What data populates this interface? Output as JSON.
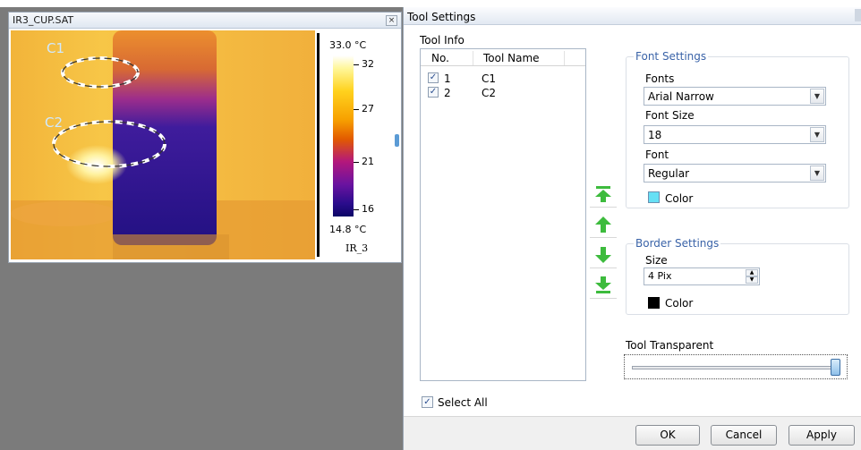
{
  "image_window": {
    "title": "IR3_CUP.SAT",
    "close_glyph": "×",
    "overlays": [
      {
        "label": "C1",
        "color": "#cfe9ff"
      },
      {
        "label": "C2",
        "color": "#cfe9ff"
      }
    ],
    "scale": {
      "max_label": "33.0 °C",
      "min_label": "14.8 °C",
      "ticks": [
        "32",
        "27",
        "21",
        "16"
      ],
      "palette_name": "IR_3"
    }
  },
  "dialog": {
    "title": "Tool Settings",
    "tool_info_label": "Tool Info",
    "columns": {
      "no": "No.",
      "name": "Tool Name"
    },
    "rows": [
      {
        "no": "1",
        "name": "C1",
        "checked": "✓"
      },
      {
        "no": "2",
        "name": "C2",
        "checked": "✓"
      }
    ],
    "select_all": {
      "label": "Select All",
      "checked": "✓"
    },
    "order_buttons": [
      "move-top",
      "move-up",
      "move-down",
      "move-bottom"
    ],
    "font_settings": {
      "title": "Font Settings",
      "fonts_label": "Fonts",
      "fonts_value": "Arial Narrow",
      "size_label": "Font Size",
      "size_value": "18",
      "style_label": "Font",
      "style_value": "Regular",
      "color_label": "Color",
      "color": "#66e0f5",
      "dropdown_glyph": "▼"
    },
    "border_settings": {
      "title": "Border Settings",
      "size_label": "Size",
      "size_value": "4 Pix",
      "color_label": "Color",
      "color": "#000000",
      "spin_up": "▲",
      "spin_down": "▼"
    },
    "transparency": {
      "label": "Tool  Transparent",
      "value_fraction": 1.0
    },
    "buttons": {
      "ok": "OK",
      "cancel": "Cancel",
      "apply": "Apply"
    }
  },
  "colors": {
    "arrow_green": "#3dbb3d",
    "group_title": "#3a63a8",
    "workspace": "#7b7b7b"
  }
}
